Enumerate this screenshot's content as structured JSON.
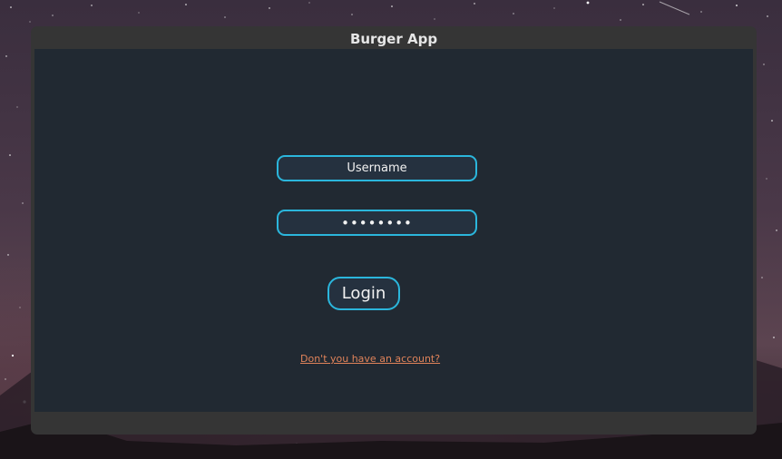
{
  "window": {
    "title": "Burger App"
  },
  "login_form": {
    "username_placeholder": "Username",
    "password_value": "password",
    "login_label": "Login",
    "signup_link": "Don't you have an account?"
  },
  "colors": {
    "accent_border": "#2bb6dc",
    "panel_background": "#212932",
    "window_frame": "#353535",
    "link": "#e0835a"
  },
  "icons": {
    "background": "night-sky-with-mountains"
  }
}
